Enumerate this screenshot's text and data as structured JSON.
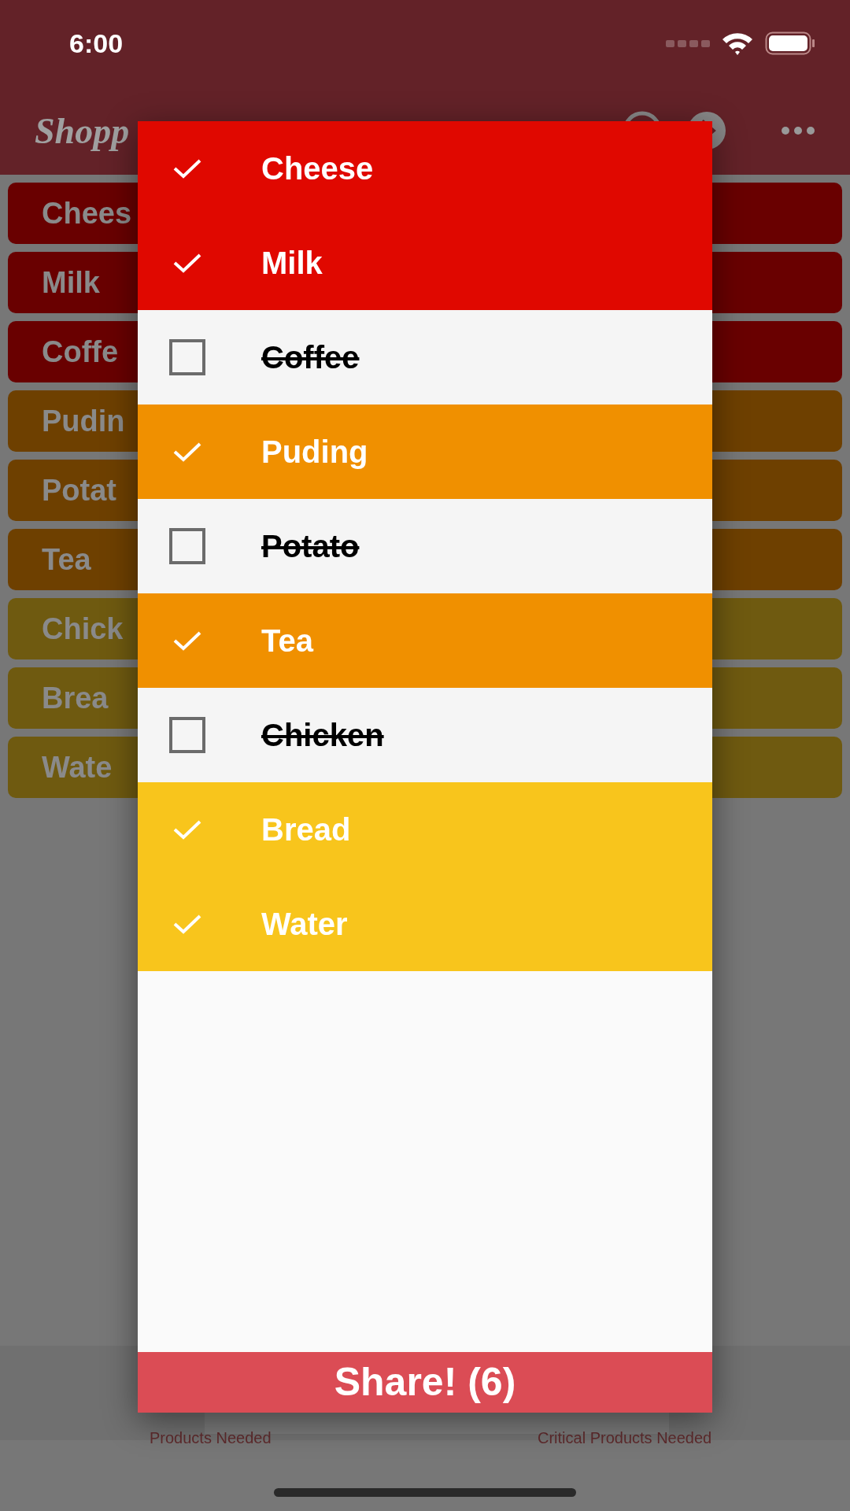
{
  "status_bar": {
    "time": "6:00"
  },
  "header": {
    "title": "Shopp"
  },
  "background_list": [
    {
      "name": "Chees",
      "color": "#690000"
    },
    {
      "name": "Milk",
      "color": "#690000"
    },
    {
      "name": "Coffe",
      "color": "#690000"
    },
    {
      "name": "Pudin",
      "color": "#6e4000"
    },
    {
      "name": "Potat",
      "color": "#6e4000"
    },
    {
      "name": "Tea",
      "color": "#6e4000"
    },
    {
      "name": "Chick",
      "color": "#6f5a10"
    },
    {
      "name": "Brea",
      "color": "#6f5a10"
    },
    {
      "name": "Wate",
      "color": "#6f5a10"
    }
  ],
  "tab_bar": {
    "tabs": [
      {
        "label": "Products Needed"
      },
      {
        "label": "Critical Products Needed"
      }
    ]
  },
  "dialog": {
    "items": [
      {
        "name": "Cheese",
        "checked": true,
        "color": "#e00800"
      },
      {
        "name": "Milk",
        "checked": true,
        "color": "#e00800"
      },
      {
        "name": "Coffee",
        "checked": false
      },
      {
        "name": "Puding",
        "checked": true,
        "color": "#f09000"
      },
      {
        "name": "Potato",
        "checked": false
      },
      {
        "name": "Tea",
        "checked": true,
        "color": "#f09000"
      },
      {
        "name": "Chicken",
        "checked": false
      },
      {
        "name": "Bread",
        "checked": true,
        "color": "#f8c51c"
      },
      {
        "name": "Water",
        "checked": true,
        "color": "#f8c51c"
      }
    ],
    "share_button": "Share! (6)"
  }
}
